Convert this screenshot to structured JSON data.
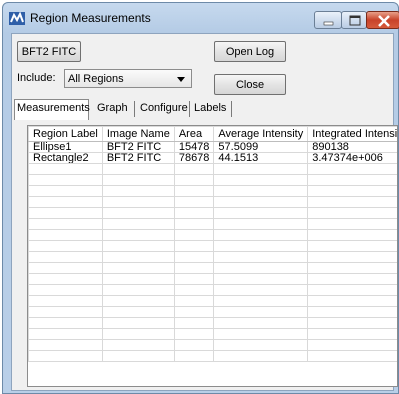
{
  "window": {
    "title": "Region Measurements"
  },
  "controls": {
    "image_button": "BFT2 FITC",
    "open_log": "Open Log",
    "include_label": "Include:",
    "include_value": "All Regions",
    "close": "Close"
  },
  "tabs": [
    {
      "label": "Measurements",
      "active": true
    },
    {
      "label": "Graph",
      "active": false
    },
    {
      "label": "Configure",
      "active": false
    },
    {
      "label": "Labels",
      "active": false
    }
  ],
  "table": {
    "columns": [
      "Region Label",
      "Image Name",
      "Area",
      "Average Intensity",
      "Integrated Intensity"
    ],
    "rows": [
      [
        "Ellipse1",
        "BFT2 FITC",
        "15478",
        "57.5099",
        "890138"
      ],
      [
        "Rectangle2",
        "BFT2 FITC",
        "78678",
        "44.1513",
        "3.47374e+006"
      ]
    ]
  },
  "colors": {
    "titlebar": "#b9cfe8",
    "close_button": "#c8432a"
  },
  "icons": {
    "app": "measurements-icon",
    "minimize": "minimize-icon",
    "maximize": "maximize-icon",
    "close": "close-icon"
  }
}
